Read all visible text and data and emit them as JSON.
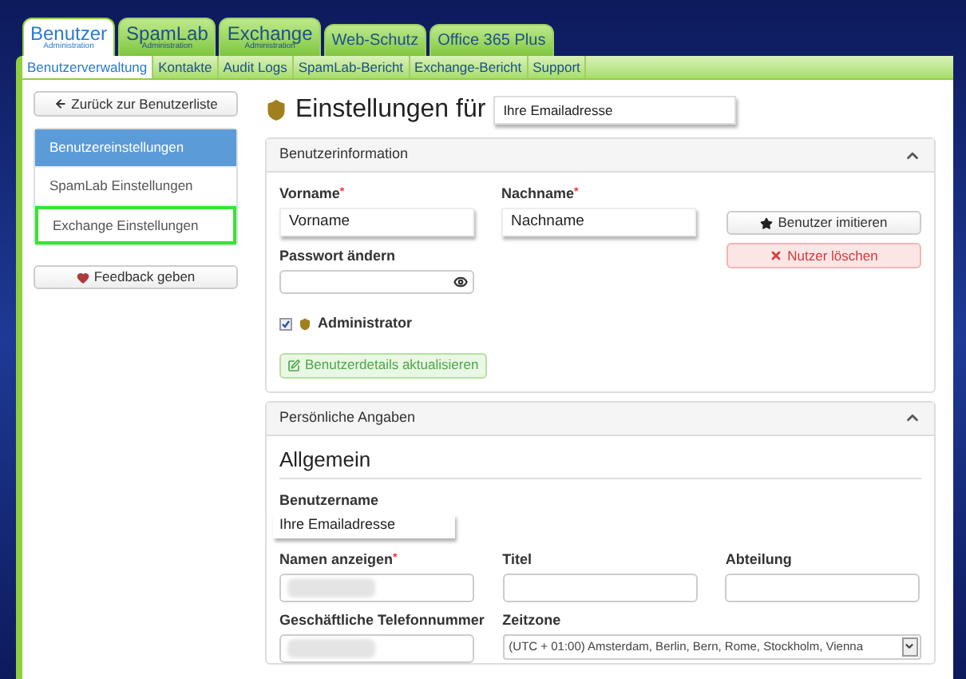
{
  "main_tabs": [
    {
      "label": "Benutzer",
      "sublabel": "Administration",
      "selected": true
    },
    {
      "label": "SpamLab",
      "sublabel": "Administration",
      "selected": false
    },
    {
      "label": "Exchange",
      "sublabel": "Administration",
      "selected": false
    },
    {
      "label": "Web-Schutz",
      "selected": false
    },
    {
      "label": "Office 365 Plus",
      "selected": false
    }
  ],
  "sub_tabs": [
    {
      "label": "Benutzerverwaltung",
      "selected": true
    },
    {
      "label": "Kontakte",
      "selected": false
    },
    {
      "label": "Audit Logs",
      "selected": false
    },
    {
      "label": "SpamLab-Bericht",
      "selected": false
    },
    {
      "label": "Exchange-Bericht",
      "selected": false
    },
    {
      "label": "Support",
      "selected": false
    }
  ],
  "sidebar": {
    "back_button": "Zurück zur Benutzerliste",
    "items": [
      {
        "label": "Benutzereinstellungen",
        "selected": true,
        "highlighted": false
      },
      {
        "label": "SpamLab Einstellungen",
        "selected": false,
        "highlighted": false
      },
      {
        "label": "Exchange Einstellungen",
        "selected": false,
        "highlighted": true
      }
    ],
    "feedback_button": "Feedback geben"
  },
  "page_title": "Einstellungen für",
  "title_email": "Ihre Emailadresse",
  "user_info": {
    "title": "Benutzerinformation",
    "expanded": true,
    "first_name": {
      "label": "Vorname",
      "required_mark": "*",
      "value": "Vorname"
    },
    "last_name": {
      "label": "Nachname",
      "required_mark": "*",
      "value": "Nachname"
    },
    "password": {
      "label": "Passwort ändern"
    },
    "administrator": {
      "label": "Administrator",
      "checked": true
    },
    "update_button": "Benutzerdetails aktualisieren",
    "impersonate_button": "Benutzer imitieren",
    "delete_button": "Nutzer löschen"
  },
  "personal": {
    "title": "Persönliche Angaben",
    "expanded": true,
    "section": "Allgemein",
    "username": {
      "label": "Benutzername",
      "value": "Ihre Emailadresse"
    },
    "fields": [
      {
        "label": "Namen anzeigen",
        "required_mark": "*",
        "redacted": true
      },
      {
        "label": "Titel",
        "redacted": false
      },
      {
        "label": "Abteilung",
        "redacted": false
      },
      {
        "label": "Geschäftliche Telefonnummer",
        "redacted": true
      }
    ],
    "timezone": {
      "label": "Zeitzone",
      "value": "(UTC + 01:00) Amsterdam, Berlin, Bern, Rome, Stockholm, Vienna"
    }
  }
}
